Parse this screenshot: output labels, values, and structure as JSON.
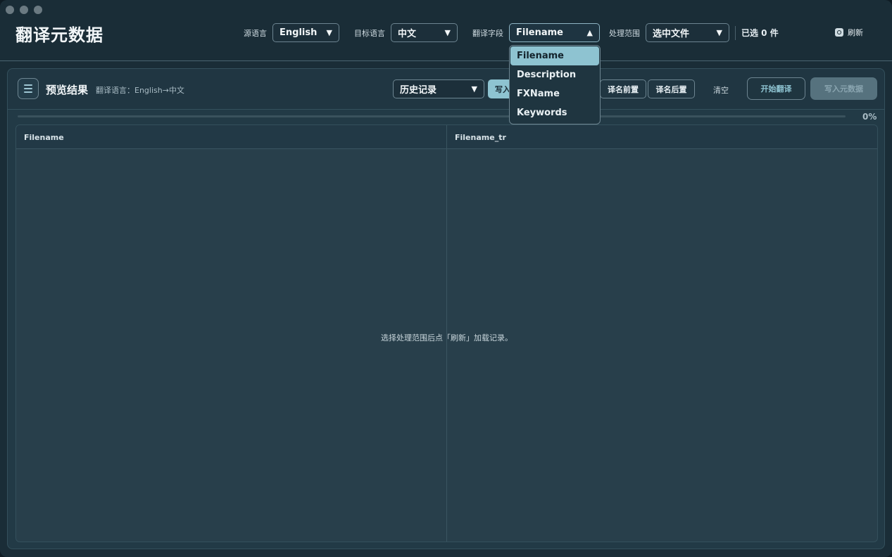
{
  "app": {
    "title": "翻译元数据"
  },
  "toolbar": {
    "source_lang_label": "源语言",
    "source_lang_value": "English",
    "target_lang_label": "目标语言",
    "target_lang_value": "中文",
    "field_label": "翻译字段",
    "field_value": "Filename",
    "scope_label": "处理范围",
    "scope_value": "选中文件",
    "selected_count": "已选 0 件",
    "refresh_label": "刷新"
  },
  "field_dropdown": {
    "options": [
      "Filename",
      "Description",
      "FXName",
      "Keywords"
    ],
    "selected": "Filename"
  },
  "preview": {
    "title": "预览结果",
    "lang_info": "翻译语言：English→中文",
    "history_value": "历史记录",
    "write_partial": "写入",
    "prefix_button": "译名前置",
    "suffix_button": "译名后置",
    "clear_button": "清空",
    "start_button": "开始翻译",
    "write_meta_button": "写入元数据",
    "progress_percent": 0,
    "progress_label": "0%"
  },
  "table": {
    "columns": [
      "Filename",
      "Filename_tr"
    ],
    "empty_message": "选择处理范围后点「刷新」加载记录。"
  },
  "icons": {
    "list": "list-icon",
    "refresh": "refresh-icon",
    "dropdown_arrow": "triangle-down-icon",
    "dropdown_open_arrow": "triangle-up-icon"
  },
  "colors": {
    "accent": "#8ec3d1",
    "background": "#1a2d37",
    "panel": "#223a46"
  }
}
